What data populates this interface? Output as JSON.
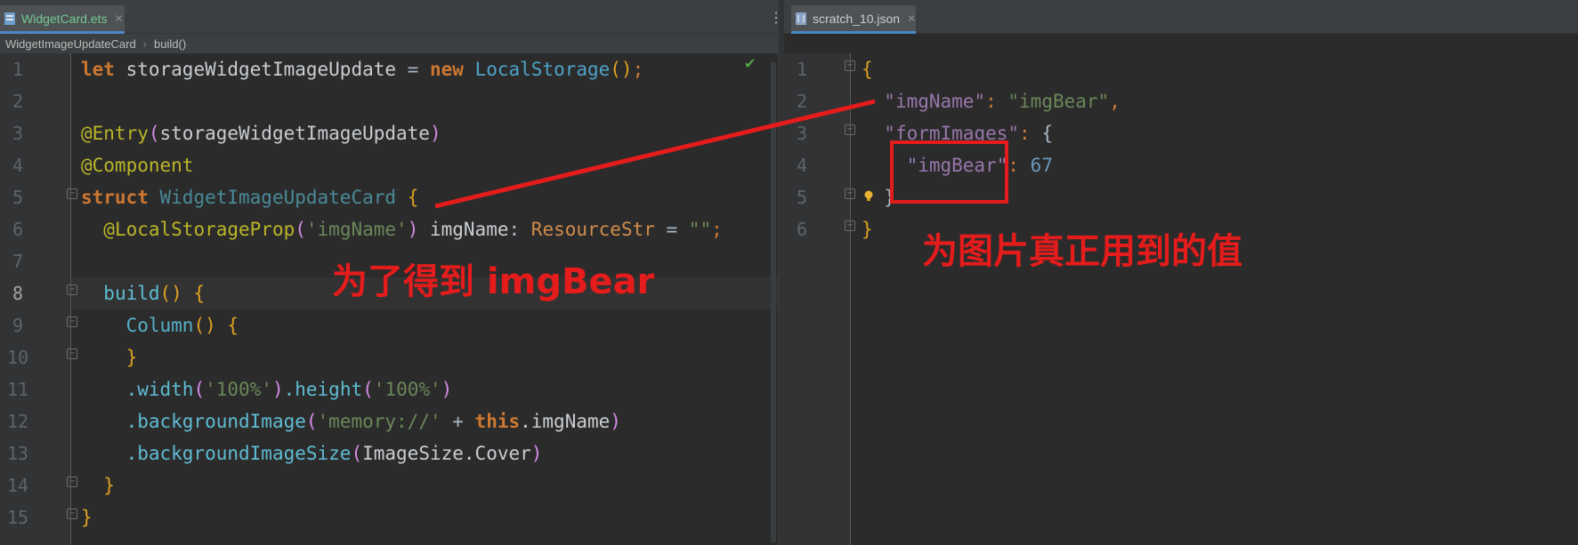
{
  "tabs": {
    "left": {
      "label": "WidgetCard.ets",
      "close": "✕"
    },
    "right": {
      "label": "scratch_10.json",
      "close": "✕"
    },
    "more": "⋮"
  },
  "breadcrumb": {
    "items": [
      "WidgetImageUpdateCard",
      "build()"
    ],
    "separator": "›"
  },
  "left_editor": {
    "line_numbers": [
      "1",
      "2",
      "3",
      "4",
      "5",
      "6",
      "7",
      "8",
      "9",
      "10",
      "11",
      "12",
      "13",
      "14",
      "15"
    ],
    "current_line": "8",
    "lines": [
      [
        "let",
        " ",
        "storageWidgetImageUpdate",
        " = ",
        "new",
        " ",
        "LocalStorage",
        "()",
        ";"
      ],
      [],
      [
        "@Entry",
        "(",
        "storageWidgetImageUpdate",
        ")"
      ],
      [
        "@Component"
      ],
      [
        "struct",
        " ",
        "WidgetImageUpdateCard",
        " ",
        "{"
      ],
      [
        "  ",
        "@LocalStorageProp",
        "(",
        "'imgName'",
        ")",
        " imgName",
        ": ",
        "ResourceStr",
        " = ",
        "\"\"",
        ";"
      ],
      [],
      [
        "  ",
        "build",
        "()",
        " ",
        "{"
      ],
      [
        "    ",
        "Column",
        "()",
        " ",
        "{"
      ],
      [
        "    ",
        "}"
      ],
      [
        "    ",
        ".width",
        "(",
        "'100%'",
        ")",
        ".height",
        "(",
        "'100%'",
        ")"
      ],
      [
        "    ",
        ".backgroundImage",
        "(",
        "'memory://'",
        " + ",
        "this",
        ".imgName",
        ")"
      ],
      [
        "    ",
        ".backgroundImageSize",
        "(",
        "ImageSize",
        ".Cover",
        ")"
      ],
      [
        "  ",
        "}"
      ],
      [
        "}"
      ]
    ]
  },
  "right_editor": {
    "line_numbers": [
      "1",
      "2",
      "3",
      "4",
      "5",
      "6"
    ],
    "lines": [
      [
        "{"
      ],
      [
        "  ",
        "\"imgName\"",
        ": ",
        "\"imgBear\"",
        ","
      ],
      [
        "  ",
        "\"formImages\"",
        ": ",
        "{"
      ],
      [
        "    ",
        "\"imgBear\"",
        ": ",
        "67"
      ],
      [
        "  ",
        "}"
      ],
      [
        "}"
      ]
    ]
  },
  "annotations": {
    "left": "为了得到 imgBear",
    "right": "为图片真正用到的值"
  },
  "colors": {
    "annotation": "#e41c1c",
    "background": "#2b2b2b"
  },
  "icons": {
    "check": "✔",
    "fold": "−"
  }
}
